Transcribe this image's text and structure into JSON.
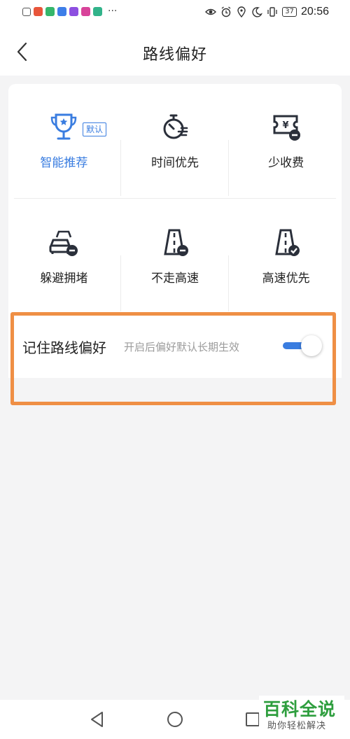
{
  "status_bar": {
    "time": "20:56",
    "battery": "37",
    "more": "···",
    "app_icons": [
      {
        "name": "alert-app-icon",
        "color": "#666666"
      },
      {
        "name": "red-app-icon",
        "color": "#e8553a"
      },
      {
        "name": "green-app-icon",
        "color": "#35b66b"
      },
      {
        "name": "blue-app-icon",
        "color": "#3d7ee8"
      },
      {
        "name": "purple-app-icon",
        "color": "#8d4fe0"
      },
      {
        "name": "magenta-app-icon",
        "color": "#d8439a"
      },
      {
        "name": "teal-app-icon",
        "color": "#32b38a"
      }
    ]
  },
  "header": {
    "title": "路线偏好",
    "back_icon": "chevron-left-icon"
  },
  "options": [
    {
      "label": "智能推荐",
      "icon": "trophy-star-icon",
      "selected": true,
      "badge": "默认"
    },
    {
      "label": "时间优先",
      "icon": "stopwatch-icon",
      "selected": false
    },
    {
      "label": "少收费",
      "icon": "toll-ticket-icon",
      "selected": false
    },
    {
      "label": "躲避拥堵",
      "icon": "traffic-cars-icon",
      "selected": false
    },
    {
      "label": "不走高速",
      "icon": "highway-minus-icon",
      "selected": false
    },
    {
      "label": "高速优先",
      "icon": "highway-check-icon",
      "selected": false
    }
  ],
  "remember": {
    "title": "记住路线偏好",
    "description": "开启后偏好默认长期生效",
    "toggle_on": true
  },
  "colors": {
    "accent": "#3a7de0",
    "highlight": "#ef8f45",
    "watermark": "#2e9e3e"
  },
  "nav_bar": {
    "back": "triangle-back-icon",
    "home": "circle-home-icon",
    "recent": "square-recent-icon"
  },
  "watermark": {
    "title": "百科全说",
    "subtitle": "助你轻松解决"
  }
}
